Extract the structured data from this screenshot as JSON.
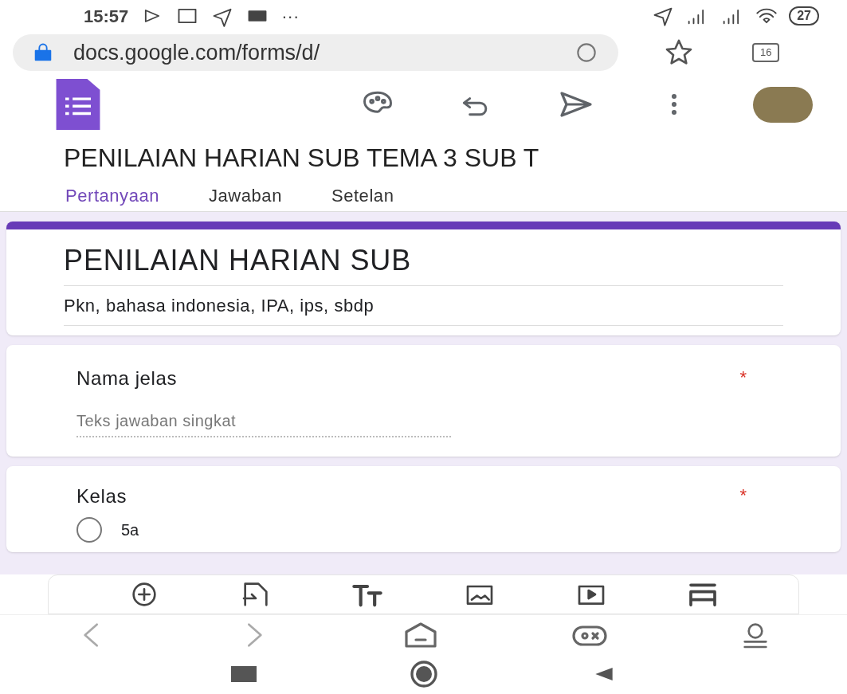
{
  "status_bar": {
    "time": "15:57",
    "more": "···",
    "battery": "27"
  },
  "browser": {
    "url": "docs.google.com/forms/d/",
    "tab_count": "16"
  },
  "form_title": "PENILAIAN HARIAN SUB TEMA 3 SUB T",
  "tabs": [
    {
      "label": "Pertanyaan",
      "selected": true
    },
    {
      "label": "Jawaban",
      "selected": false
    },
    {
      "label": "Setelan",
      "selected": false
    }
  ],
  "header": {
    "title": "PENILAIAN HARIAN SUB",
    "description": "Pkn, bahasa indonesia, IPA, ips, sbdp"
  },
  "questions": [
    {
      "kind": "short_answer",
      "title": "Nama jelas",
      "required_mark": "*",
      "placeholder": "Teks jawaban singkat"
    },
    {
      "kind": "radio",
      "title": "Kelas",
      "required_mark": "*",
      "options": [
        {
          "label": "5a",
          "selected": false
        }
      ]
    }
  ]
}
